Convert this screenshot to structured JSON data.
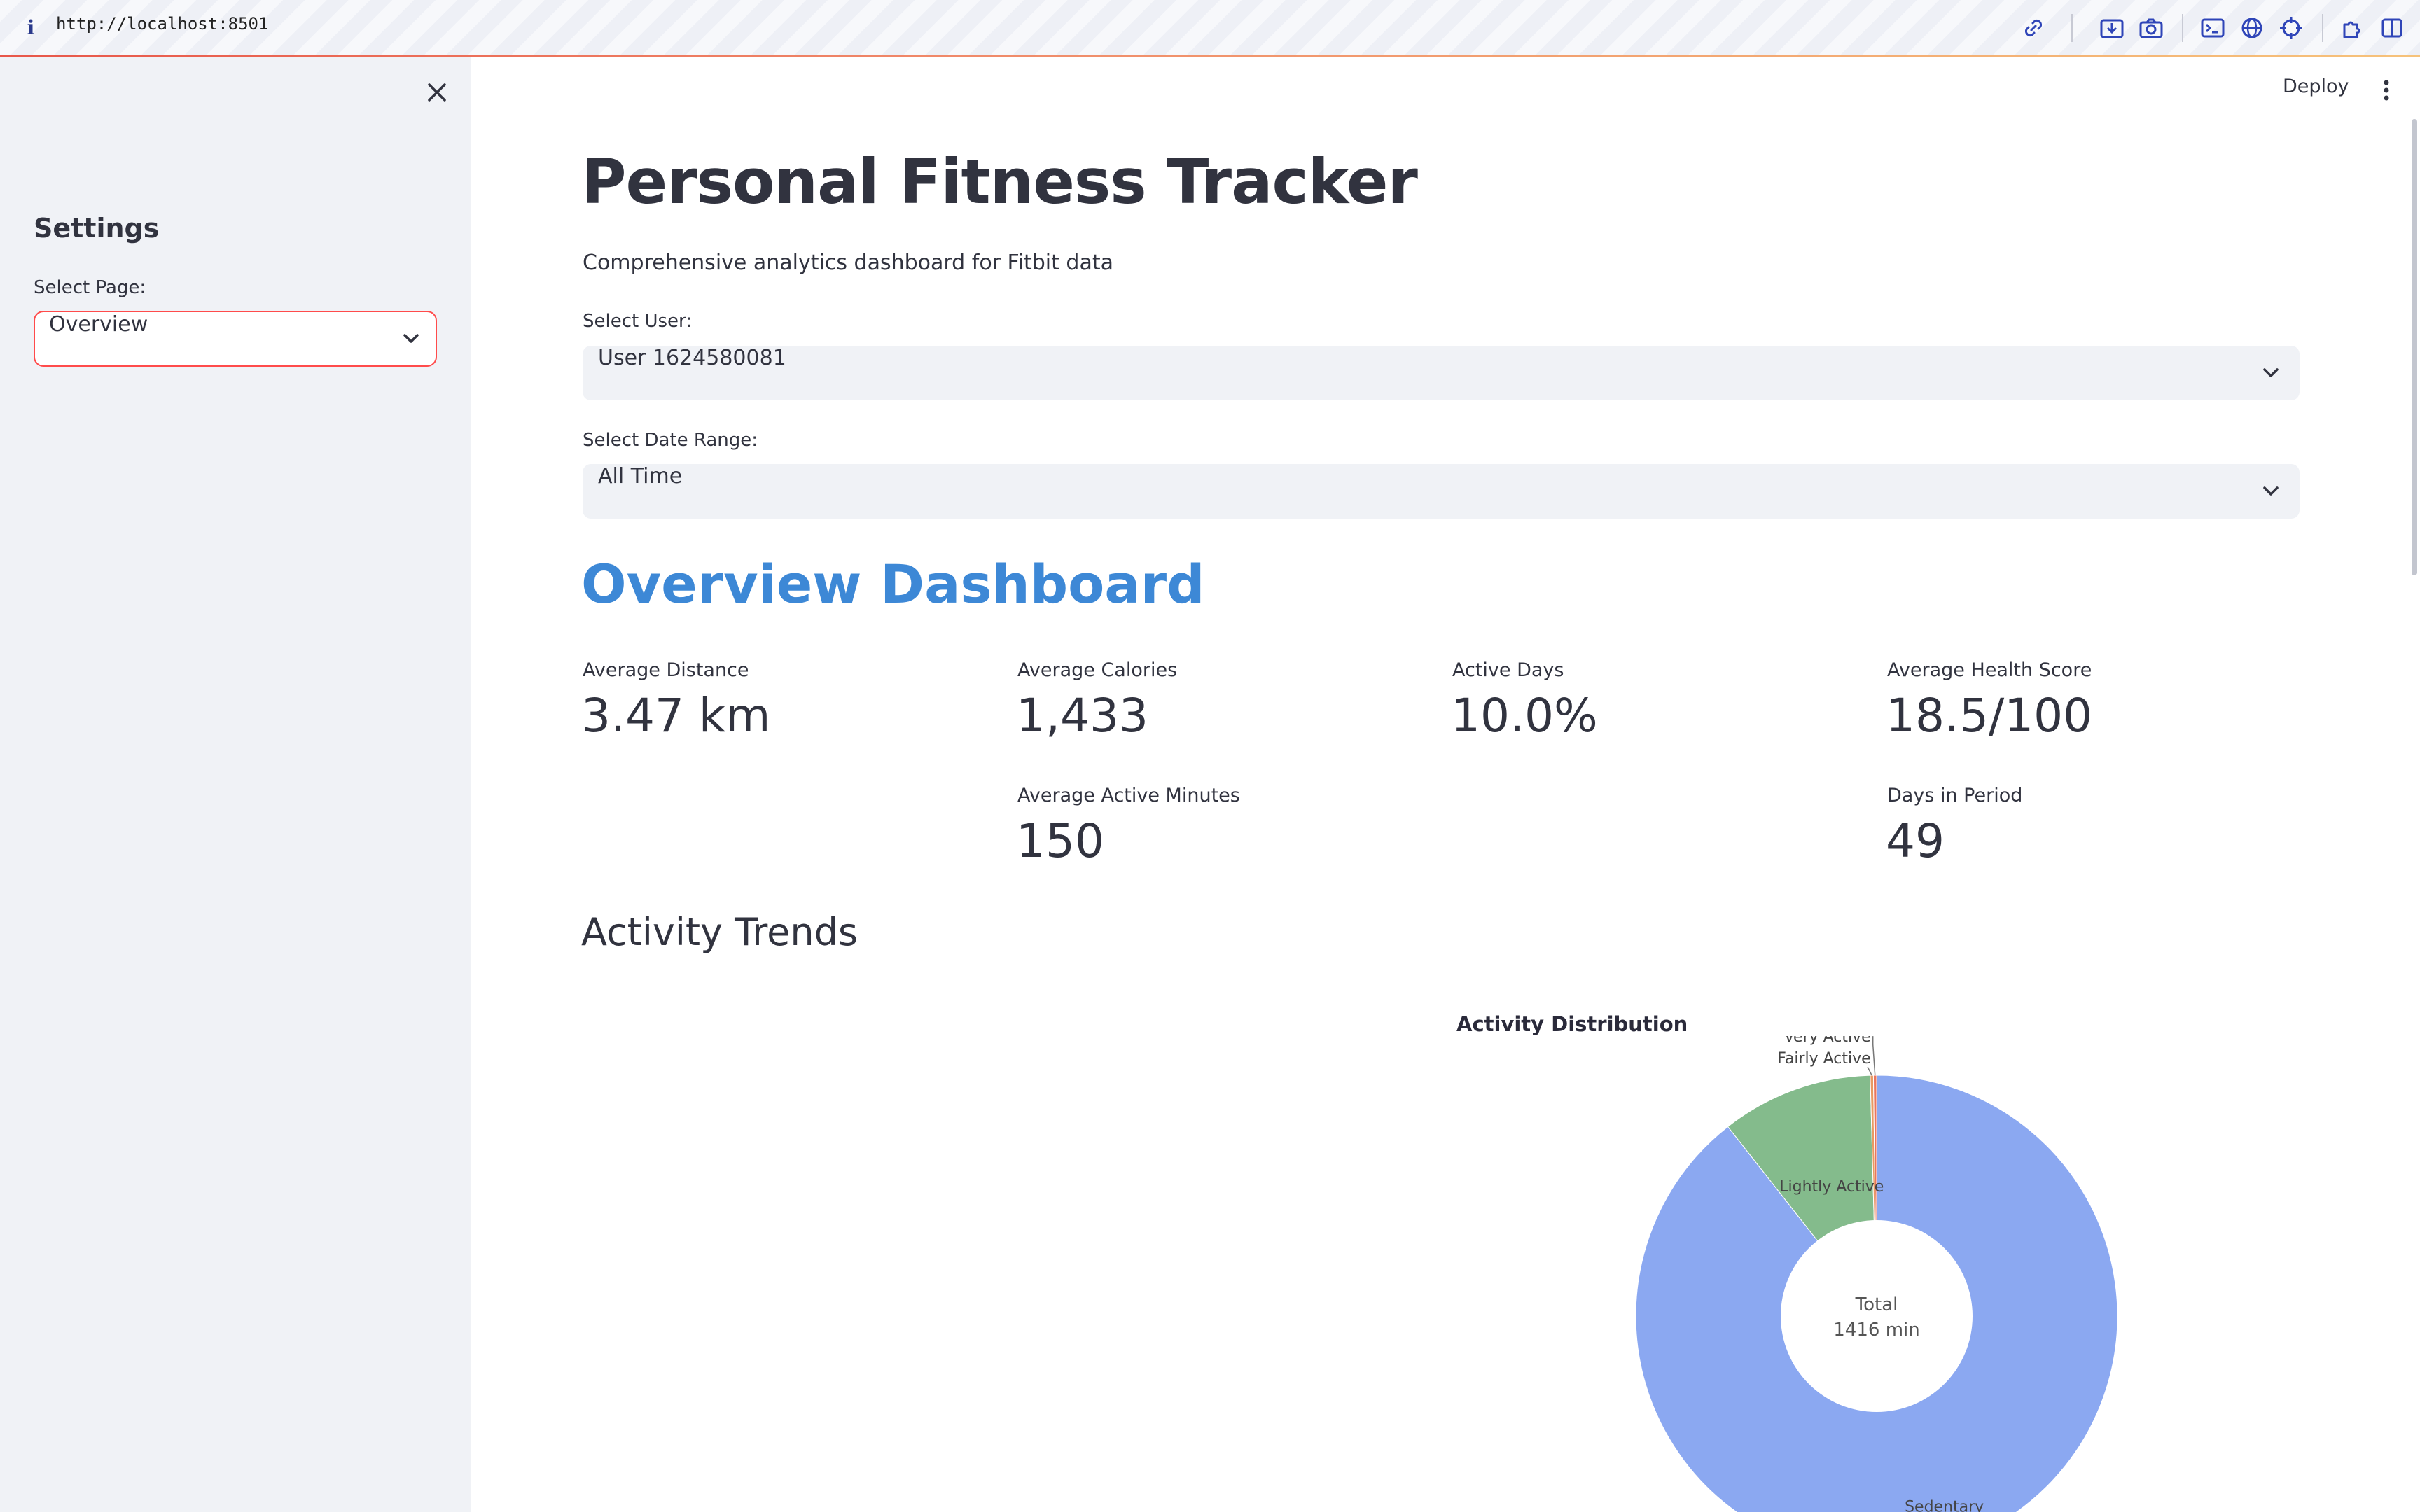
{
  "browser": {
    "url": "http://localhost:8501",
    "toolbar_icons": [
      "link-icon",
      "save-icon",
      "camera-icon",
      "terminal-icon",
      "globe-icon",
      "crosshair-icon",
      "extension-icon",
      "sidebar-toggle-icon"
    ]
  },
  "sidebar": {
    "title": "Settings",
    "select_label": "Select Page:",
    "select_value": "Overview"
  },
  "header": {
    "deploy_label": "Deploy"
  },
  "main": {
    "title": "Personal Fitness Tracker",
    "subtitle": "Comprehensive analytics dashboard for Fitbit data",
    "user_label": "Select User:",
    "user_value": "User 1624580081",
    "date_label": "Select Date Range:",
    "date_value": "All Time",
    "section_title": "Overview Dashboard",
    "metrics": [
      {
        "label": "Average Distance",
        "value": "3.47 km"
      },
      {
        "label": "Average Calories",
        "value": "1,433"
      },
      {
        "label": "Active Days",
        "value": "10.0%"
      },
      {
        "label": "Average Health Score",
        "value": "18.5/100"
      },
      {
        "label": "Average Active Minutes",
        "value": "150"
      },
      {
        "label": "Days in Period",
        "value": "49"
      }
    ],
    "trends_title": "Activity Trends"
  },
  "chart_data": {
    "type": "pie",
    "title": "Activity Distribution",
    "center_label": "Total",
    "center_value": "1416 min",
    "categories": [
      "Sedentary",
      "Lightly Active",
      "Fairly Active",
      "Very Active"
    ],
    "values": [
      1266,
      144,
      3,
      3
    ],
    "colors": [
      "#8ba8f1",
      "#84bb8c",
      "#e89a62",
      "#e9765e"
    ],
    "legend": "none"
  }
}
